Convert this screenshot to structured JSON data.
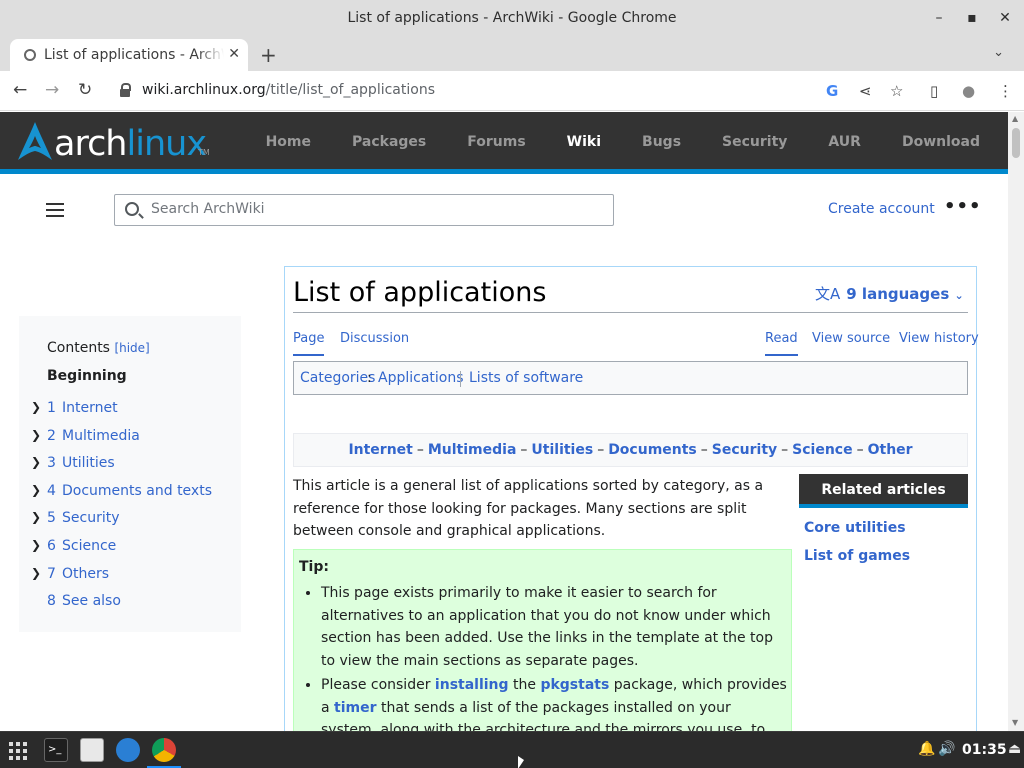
{
  "window": {
    "title": "List of applications - ArchWiki - Google Chrome",
    "minimize": "–",
    "maximize": "▪",
    "close": "✕"
  },
  "tab": {
    "title": "List of applications - ArchWiki",
    "close": "✕",
    "newtab": "+",
    "dropdown": "⌄"
  },
  "toolbar": {
    "back": "←",
    "forward": "→",
    "reload": "↻",
    "url_host": "wiki.archlinux.org",
    "url_path": "/title/list_of_applications",
    "google": "G",
    "share": "⋖",
    "star": "☆",
    "sidepanel": "▯",
    "profile": "●",
    "menu": "⋮"
  },
  "site": {
    "logo_arch": "arch",
    "logo_linux": "linux",
    "logo_tm": "TM",
    "nav": [
      "Home",
      "Packages",
      "Forums",
      "Wiki",
      "Bugs",
      "Security",
      "AUR",
      "Download"
    ],
    "active_nav": "Wiki",
    "search_placeholder": "Search ArchWiki",
    "create_account": "Create account",
    "more": "•••"
  },
  "toc": {
    "heading": "Contents",
    "hide": "[hide]",
    "beginning": "Beginning",
    "items": [
      {
        "num": "1",
        "label": "Internet",
        "expandable": true
      },
      {
        "num": "2",
        "label": "Multimedia",
        "expandable": true
      },
      {
        "num": "3",
        "label": "Utilities",
        "expandable": true
      },
      {
        "num": "4",
        "label": "Documents and texts",
        "expandable": true
      },
      {
        "num": "5",
        "label": "Security",
        "expandable": true
      },
      {
        "num": "6",
        "label": "Science",
        "expandable": true
      },
      {
        "num": "7",
        "label": "Others",
        "expandable": true
      },
      {
        "num": "8",
        "label": "See also",
        "expandable": false
      }
    ]
  },
  "article": {
    "title": "List of applications",
    "languages": "9 languages",
    "tabs_left": [
      "Page",
      "Discussion"
    ],
    "tabs_right": [
      "Read",
      "View source",
      "View history"
    ],
    "categories_label": "Categories",
    "categories": [
      "Applications",
      "Lists of software"
    ],
    "sections": [
      "Internet",
      "Multimedia",
      "Utilities",
      "Documents",
      "Security",
      "Science",
      "Other"
    ],
    "intro": "This article is a general list of applications sorted by category, as a reference for those looking for packages. Many sections are split between console and graphical applications.",
    "related_heading": "Related articles",
    "related": [
      "Core utilities",
      "List of games"
    ],
    "tip_heading": "Tip:",
    "tip1": "This page exists primarily to make it easier to search for alternatives to an application that you do not know under which section has been added. Use the links in the template at the top to view the main sections as separate pages.",
    "tip2_a": "Please consider ",
    "tip2_link1": "installing",
    "tip2_b": " the ",
    "tip2_link2": "pkgstats",
    "tip2_c": " package, which provides a ",
    "tip2_link3": "timer",
    "tip2_d": " that sends a list of the packages installed on your system, along with the architecture and the mirrors you use, to the Arch Linux developers in order"
  },
  "taskbar": {
    "clock": "01:35",
    "bell": "🔔",
    "volume": "🔊",
    "logout": "⏏"
  },
  "colors": {
    "link": "#3366cc",
    "arch_blue": "#1793d1",
    "header_bg": "#333333",
    "tip_bg": "#ddffdd"
  }
}
